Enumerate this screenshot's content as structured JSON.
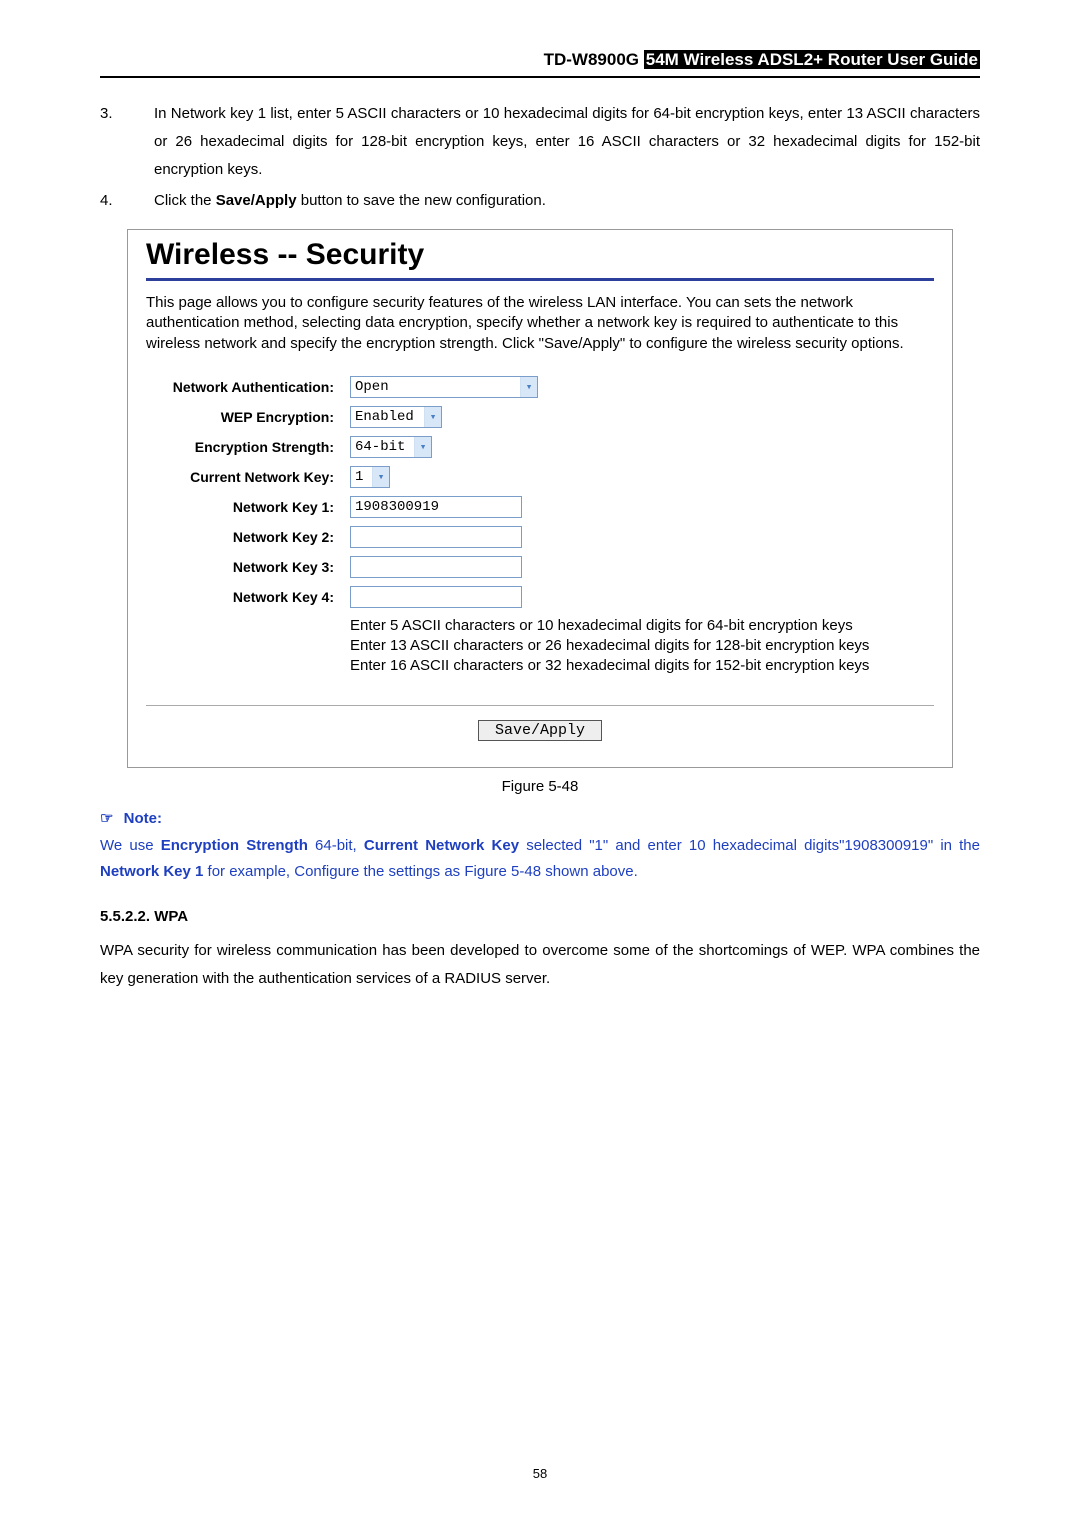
{
  "header": {
    "model": "TD-W8900G",
    "guide": "54M Wireless ADSL2+ Router User Guide"
  },
  "list": {
    "item3": {
      "num": "3.",
      "text": "In Network key 1 list, enter 5 ASCII characters or 10 hexadecimal digits for 64-bit encryption keys, enter 13 ASCII characters or 26 hexadecimal digits for 128-bit encryption keys, enter 16 ASCII characters or 32 hexadecimal digits for 152-bit encryption keys."
    },
    "item4": {
      "num": "4.",
      "pre": "Click the ",
      "bold": "Save/Apply",
      "post": " button to save the new configuration."
    }
  },
  "screenshot": {
    "title": "Wireless -- Security",
    "desc": "This page allows you to configure security features of the wireless LAN interface. You can sets the network authentication method, selecting data encryption, specify whether a network key is required to authenticate to this wireless network and specify the encryption strength. Click \"Save/Apply\" to configure the wireless security options.",
    "labels": {
      "auth": "Network Authentication:",
      "wep": "WEP Encryption:",
      "strength": "Encryption Strength:",
      "current": "Current Network Key:",
      "k1": "Network Key 1:",
      "k2": "Network Key 2:",
      "k3": "Network Key 3:",
      "k4": "Network Key 4:"
    },
    "values": {
      "auth": "Open",
      "wep": "Enabled",
      "strength": "64-bit",
      "current": "1",
      "k1": "1908300919",
      "k2": "",
      "k3": "",
      "k4": ""
    },
    "hint": {
      "l1": "Enter 5 ASCII characters or 10 hexadecimal digits for 64-bit encryption keys",
      "l2": "Enter 13 ASCII characters or 26 hexadecimal digits for 128-bit encryption keys",
      "l3": "Enter 16 ASCII characters or 32 hexadecimal digits for 152-bit encryption keys"
    },
    "save": "Save/Apply"
  },
  "figcaption": "Figure 5-48",
  "note": {
    "icon": "☞",
    "label": "Note:",
    "p1": "We use ",
    "b1": "Encryption Strength",
    "p2": " 64-bit, ",
    "b2": "Current Network Key",
    "p3": " selected \"1\" and enter 10 hexadecimal digits\"1908300919\" in the ",
    "b3": "Network Key 1",
    "p4": " for example, Configure the settings as Figure 5-48 shown above."
  },
  "sub": {
    "heading": "5.5.2.2.  WPA",
    "para": "WPA security for wireless communication has been developed to overcome some of the shortcomings of WEP. WPA combines the key generation with the authentication services of a RADIUS server."
  },
  "pagenum": "58"
}
